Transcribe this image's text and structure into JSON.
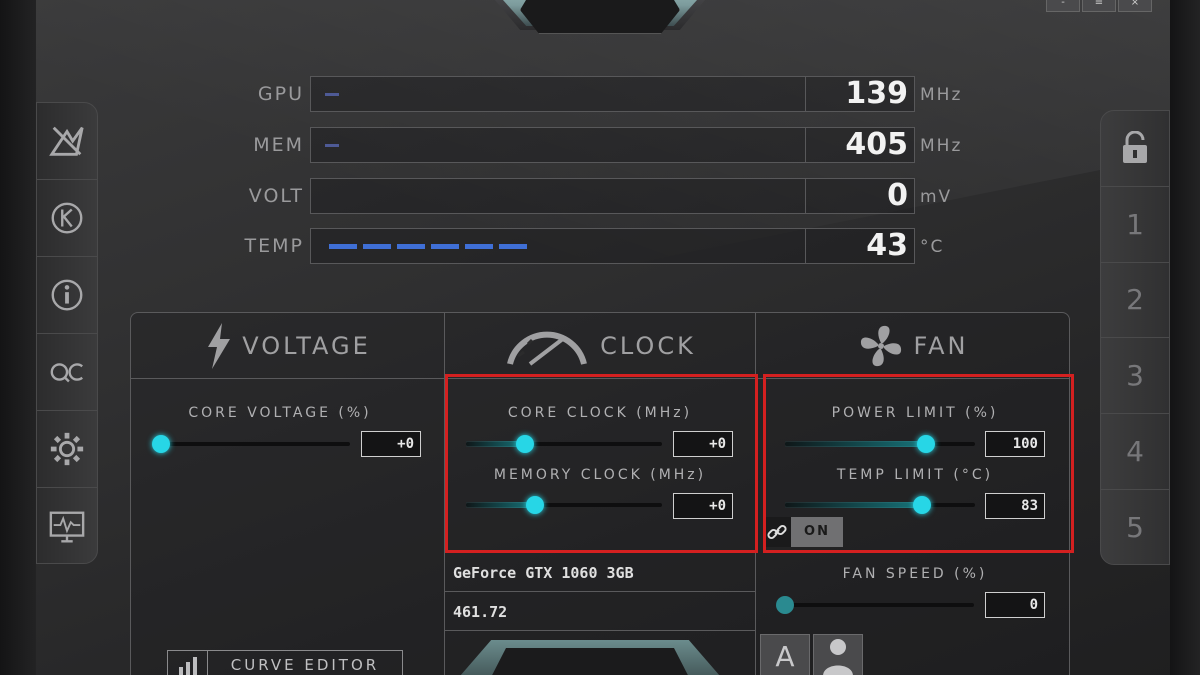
{
  "window": {
    "buttons": [
      "-",
      "≡",
      "×"
    ]
  },
  "monitor": [
    {
      "label": "GPU",
      "value": "139",
      "unit": "MHz",
      "level": 0.02
    },
    {
      "label": "MEM",
      "value": "405",
      "unit": "MHz",
      "level": 0.02
    },
    {
      "label": "VOLT",
      "value": "0",
      "unit": "mV",
      "level": 0
    },
    {
      "label": "TEMP",
      "value": "43",
      "unit": "°C",
      "level": 0.4
    }
  ],
  "tabs": {
    "voltage": "VOLTAGE",
    "clock": "CLOCK",
    "fan": "FAN"
  },
  "voltage": {
    "core_voltage_label": "CORE VOLTAGE  (%)",
    "core_voltage_value": "+0",
    "core_voltage_level": 0,
    "curve_editor_label": "CURVE EDITOR"
  },
  "clock": {
    "core_clock_label": "CORE CLOCK (MHz)",
    "core_clock_value": "+0",
    "core_clock_level": 0.3,
    "memory_clock_label": "MEMORY CLOCK (MHz)",
    "memory_clock_value": "+0",
    "memory_clock_level": 0.35
  },
  "gpu_info": {
    "name": "GeForce GTX 1060 3GB",
    "driver": "461.72"
  },
  "fan": {
    "power_limit_label": "POWER LIMIT  (%)",
    "power_limit_value": "100",
    "power_limit_level": 0.74,
    "temp_limit_label": "TEMP LIMIT (°C)",
    "temp_limit_value": "83",
    "temp_limit_level": 0.72,
    "link_label": "ON",
    "fan_speed_label": "FAN SPEED  (%)",
    "fan_speed_value": "0",
    "fan_speed_level": 0,
    "auto_label": "A"
  },
  "profiles": {
    "lock_icon": "lock-icon",
    "items": [
      "1",
      "2",
      "3",
      "4",
      "5"
    ]
  },
  "sidebar": {
    "icons": [
      "msi-kombustor-icon",
      "k-boost-icon",
      "info-icon",
      "oc-scanner-icon",
      "settings-icon",
      "monitor-icon"
    ]
  },
  "colors": {
    "accent": "#27d6e6",
    "highlight": "#d42020",
    "temp_bar": "#3f6fd6"
  }
}
